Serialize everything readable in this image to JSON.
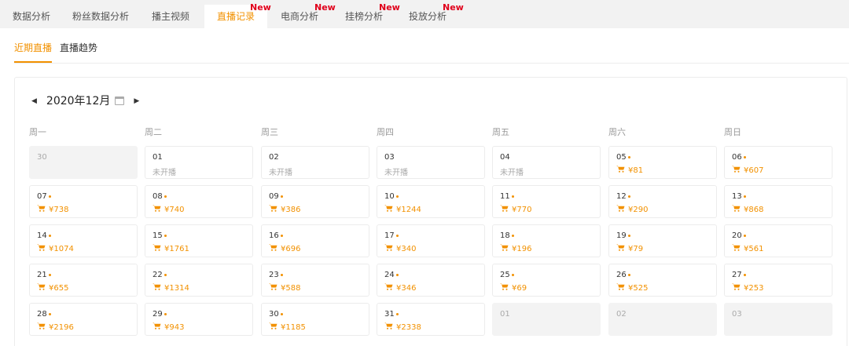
{
  "tabs": [
    {
      "label": "数据分析",
      "active": false,
      "new": false
    },
    {
      "label": "粉丝数据分析",
      "active": false,
      "new": false
    },
    {
      "label": "播主视频",
      "active": false,
      "new": false
    },
    {
      "label": "直播记录",
      "active": true,
      "new": true
    },
    {
      "label": "电商分析",
      "active": false,
      "new": true
    },
    {
      "label": "挂榜分析",
      "active": false,
      "new": true
    },
    {
      "label": "投放分析",
      "active": false,
      "new": true
    }
  ],
  "new_badge": "New",
  "subtabs": [
    {
      "label": "近期直播",
      "active": true
    },
    {
      "label": "直播趋势",
      "active": false
    }
  ],
  "calendar": {
    "month_label": "2020年12月",
    "weekdays": [
      "周一",
      "周二",
      "周三",
      "周四",
      "周五",
      "周六",
      "周日"
    ],
    "not_live_label": "未开播",
    "days": [
      {
        "date": "30",
        "muted": true
      },
      {
        "date": "01",
        "status": "未开播"
      },
      {
        "date": "02",
        "status": "未开播"
      },
      {
        "date": "03",
        "status": "未开播"
      },
      {
        "date": "04",
        "status": "未开播"
      },
      {
        "date": "05",
        "amount": "¥81"
      },
      {
        "date": "06",
        "amount": "¥607"
      },
      {
        "date": "07",
        "amount": "¥738"
      },
      {
        "date": "08",
        "amount": "¥740"
      },
      {
        "date": "09",
        "amount": "¥386"
      },
      {
        "date": "10",
        "amount": "¥1244"
      },
      {
        "date": "11",
        "amount": "¥770"
      },
      {
        "date": "12",
        "amount": "¥290"
      },
      {
        "date": "13",
        "amount": "¥868"
      },
      {
        "date": "14",
        "amount": "¥1074"
      },
      {
        "date": "15",
        "amount": "¥1761"
      },
      {
        "date": "16",
        "amount": "¥696"
      },
      {
        "date": "17",
        "amount": "¥340"
      },
      {
        "date": "18",
        "amount": "¥196"
      },
      {
        "date": "19",
        "amount": "¥79"
      },
      {
        "date": "20",
        "amount": "¥561"
      },
      {
        "date": "21",
        "amount": "¥655"
      },
      {
        "date": "22",
        "amount": "¥1314"
      },
      {
        "date": "23",
        "amount": "¥588"
      },
      {
        "date": "24",
        "amount": "¥346"
      },
      {
        "date": "25",
        "amount": "¥69"
      },
      {
        "date": "26",
        "amount": "¥525"
      },
      {
        "date": "27",
        "amount": "¥253"
      },
      {
        "date": "28",
        "amount": "¥2196"
      },
      {
        "date": "29",
        "amount": "¥943"
      },
      {
        "date": "30",
        "amount": "¥1185"
      },
      {
        "date": "31",
        "amount": "¥2338"
      },
      {
        "date": "01",
        "muted": true
      },
      {
        "date": "02",
        "muted": true
      },
      {
        "date": "03",
        "muted": true
      }
    ]
  },
  "colors": {
    "accent": "#f29100",
    "new_badge": "#e0001b",
    "tabbar_bg": "#f2f2f2"
  },
  "icons": {
    "prev": "caret-left-icon",
    "next": "caret-right-icon",
    "calendar": "calendar-icon",
    "cart": "cart-icon"
  }
}
